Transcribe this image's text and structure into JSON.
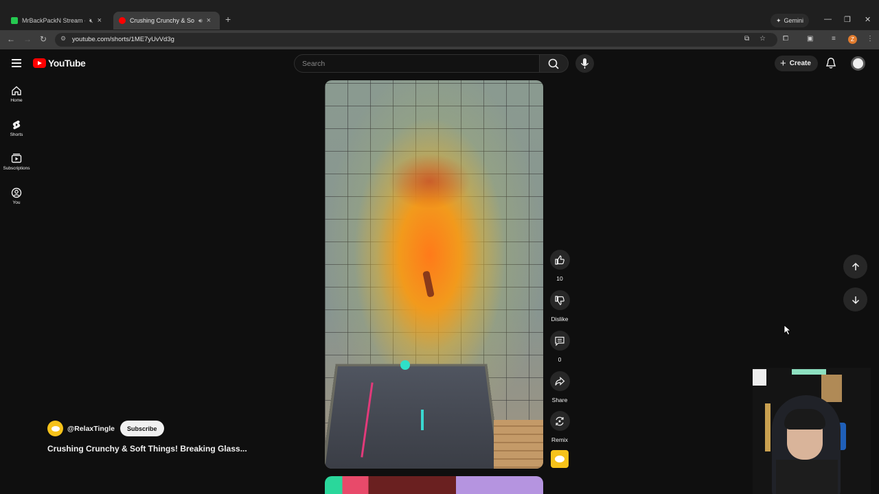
{
  "browser": {
    "tabs": [
      {
        "title": "MrBackPackN Stream - Wa",
        "favicon_color": "#25c950",
        "active": false
      },
      {
        "title": "Crushing Crunchy & Soft Th",
        "favicon_color": "#ff0000",
        "active": true
      }
    ],
    "gemini_label": "Gemini",
    "url": "youtube.com/shorts/1ME7yUvVd3g",
    "profile_initial": "Z"
  },
  "youtube": {
    "logo_text": "YouTube",
    "search_placeholder": "Search",
    "create_label": "Create",
    "sidebar": [
      {
        "label": "Home",
        "icon": "home-icon"
      },
      {
        "label": "Shorts",
        "icon": "shorts-icon"
      },
      {
        "label": "Subscriptions",
        "icon": "subscriptions-icon"
      },
      {
        "label": "You",
        "icon": "you-icon"
      }
    ],
    "actions": {
      "like_count": "10",
      "dislike_label": "Dislike",
      "comment_count": "0",
      "share_label": "Share",
      "remix_label": "Remix"
    },
    "channel": {
      "handle": "@RelaxTingle",
      "subscribe_label": "Subscribe",
      "avatar_color": "#f6c21a"
    },
    "video_title": "Crushing Crunchy & Soft Things! Breaking Glass..."
  },
  "colors": {
    "accent_red": "#ff0000",
    "background": "#0f0f0f",
    "button_bg": "#272727"
  }
}
